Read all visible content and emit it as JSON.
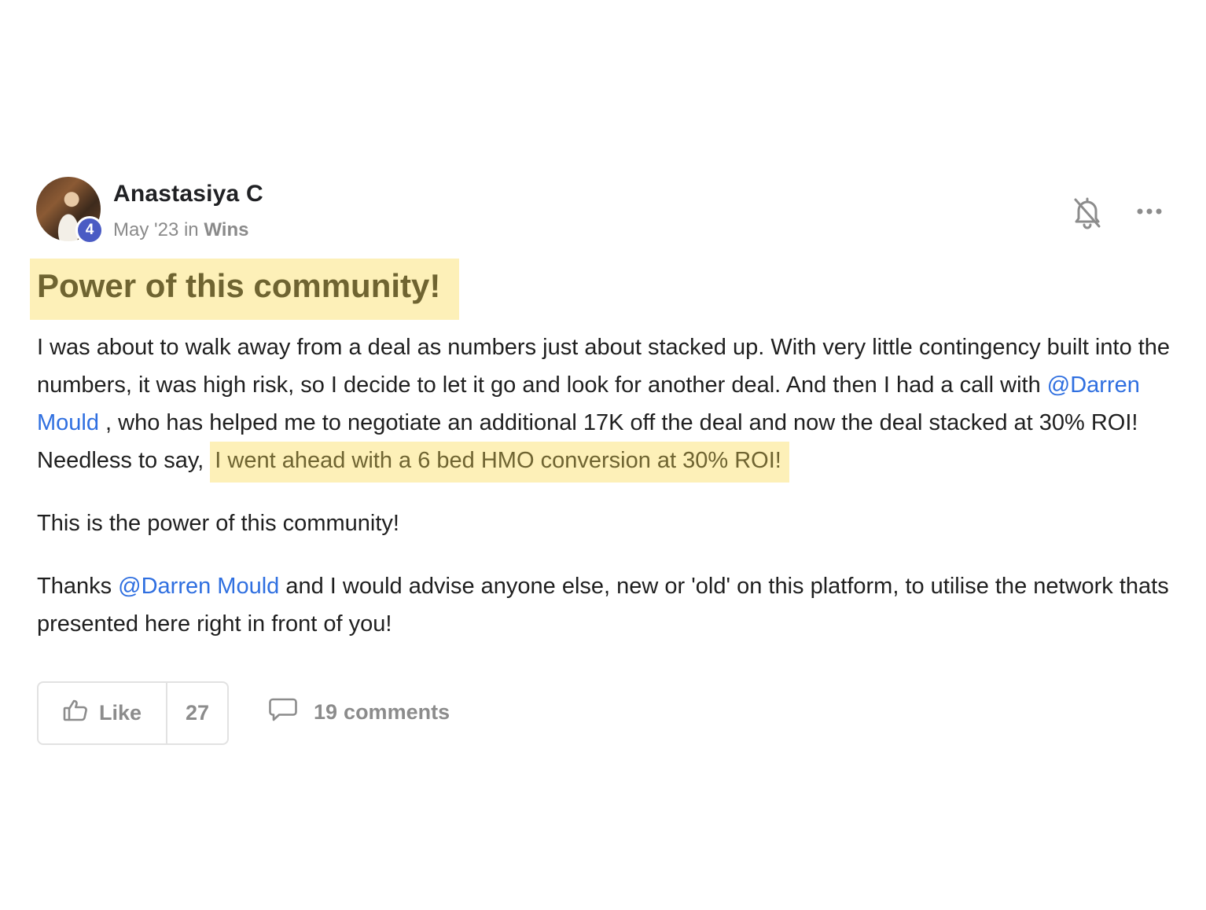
{
  "author": {
    "name": "Anastasiya C",
    "level": "4",
    "date": "May '23",
    "in_word": "in",
    "category": "Wins"
  },
  "icons": {
    "bell": "bell-off-icon",
    "more": "more-horizontal-icon",
    "like": "thumbs-up-icon",
    "comment": "comment-bubble-icon"
  },
  "post": {
    "title": "Power of this community!",
    "p1_a": "I was about to walk away from a deal as numbers just about stacked up. With very little contingency built into the numbers, it was high risk, so I decide to let it go and look for another deal. And then I had a call with ",
    "p1_mention": "@Darren Mould",
    "p1_b": " , who has helped me to negotiate an additional 17K off the deal and now the deal stacked at 30% ROI! Needless to say, ",
    "p1_highlight": "I went ahead with a 6 bed HMO conversion at 30% ROI!",
    "p2": "This is the power of this community!",
    "p3_a": "Thanks ",
    "p3_mention": "@Darren Mould",
    "p3_b": " and I would advise anyone else, new or 'old' on this platform, to utilise the network thats presented here right in front of you!"
  },
  "footer": {
    "like_label": "Like",
    "like_count": "27",
    "comments_count": "19",
    "comments_label": "comments"
  },
  "colors": {
    "highlight_bg": "#fdf0b8",
    "highlight_text": "#6f6431",
    "mention": "#2f6fe0",
    "badge": "#4a5bc4",
    "muted": "#8c8c8c"
  }
}
